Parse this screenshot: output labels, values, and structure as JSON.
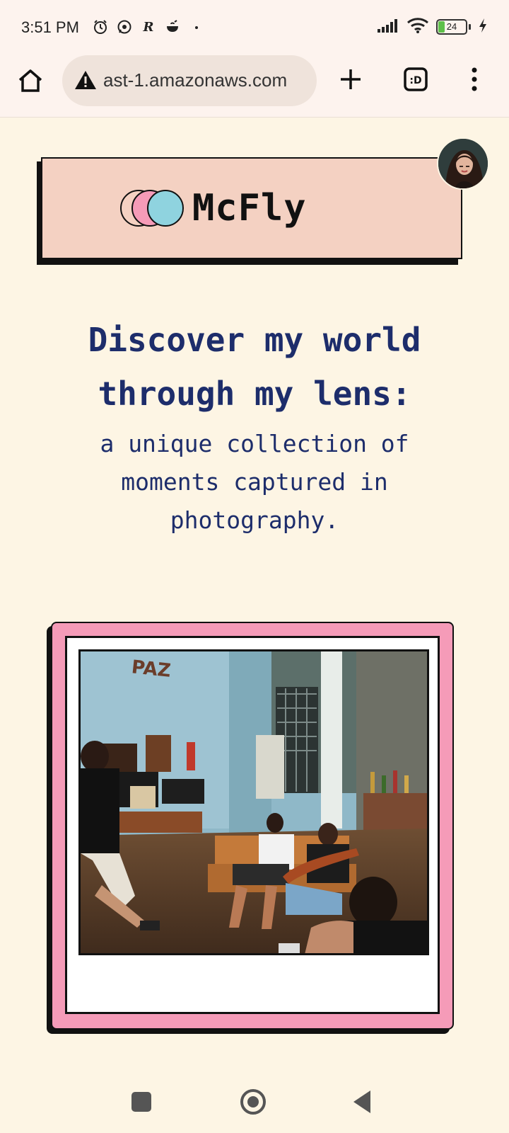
{
  "status_bar": {
    "time": "3:51 PM",
    "notification_icons": [
      "alarm-icon",
      "whatsapp-icon",
      "r-app-icon",
      "cooking-pot-icon",
      "more-dot-icon"
    ],
    "battery_level": "24",
    "battery_percent": 24,
    "right_icons": [
      "signal-icon",
      "wifi-icon",
      "battery-icon",
      "charging-icon"
    ]
  },
  "browser": {
    "url": "ast-1.amazonaws.com",
    "security": "not-secure-warning-icon",
    "tab_count_label": ":D"
  },
  "header": {
    "brand": "McFly",
    "logo_colors": [
      "#f4d1c2",
      "#f59bb8",
      "#8fd3df"
    ]
  },
  "hero": {
    "title_line1": "Discover my world",
    "title_line2": "through my lens:",
    "subtitle_line1": "a unique collection of",
    "subtitle_line2": "moments captured in",
    "subtitle_line3": "photography."
  },
  "gallery": {
    "frame_color": "#f59bb8",
    "photo_sign": "PAZ"
  },
  "colors": {
    "background": "#fdf5e4",
    "header_card": "#f4d1c2",
    "hero_text": "#1d2d6b"
  }
}
